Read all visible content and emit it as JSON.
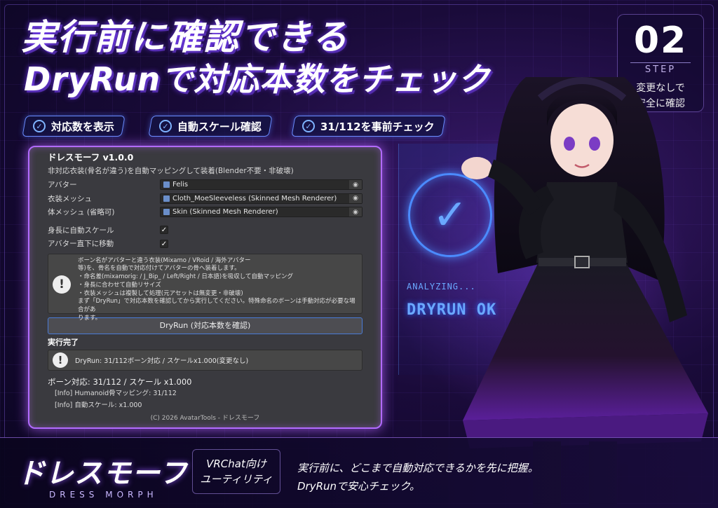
{
  "headline": {
    "line1": "実行前に確認できる",
    "line2": "DryRunで対応本数をチェック"
  },
  "step": {
    "number": "02",
    "label": "STEP",
    "desc_line1": "変更なしで",
    "desc_line2": "安全に確認"
  },
  "chips": [
    {
      "label": "対応数を表示"
    },
    {
      "label": "自動スケール確認"
    },
    {
      "label": "31/112を事前チェック"
    }
  ],
  "panel": {
    "title": "ドレスモーフ v1.0.0",
    "subtitle": "非対応衣装(骨名が違う)を自動マッピングして装着(Blender不要・非破壊)",
    "fields": [
      {
        "label": "アバター",
        "value": "Felis"
      },
      {
        "label": "衣装メッシュ",
        "value": "Cloth_MoeSleeveless (Skinned Mesh Renderer)"
      },
      {
        "label": "体メッシュ (省略可)",
        "value": "Skin (Skinned Mesh Renderer)"
      }
    ],
    "toggles": [
      {
        "label": "身長に自動スケール",
        "check": "✓"
      },
      {
        "label": "アバター直下に移動",
        "check": "✓"
      }
    ],
    "help_lines": [
      "ボーン名がアバターと違う衣装(Mixamo / VRoid / 海外アバター",
      "等)を、骨名を自動で対応付けてアバターの骨へ装着します。",
      "・命名差(mixamorig: / J_Bip_ / Left/Right / 日本語)を吸収して自動マッピング",
      "・身長に合わせて自動リサイズ",
      "・衣装メッシュは複製して処理(元アセットは無変更・非破壊)",
      "まず「DryRun」で対応本数を確認してから実行してください。特殊命名のボーンは手動対応が必要な場合があ",
      "ります。"
    ],
    "help_icon": "!",
    "dryrun_button": "DryRun (対応本数を確認)",
    "result_heading": "実行完了",
    "result_icon": "!",
    "result_text": "DryRun: 31/112ボーン対応 / スケールx1.000(変更なし)",
    "summary": "ボーン対応: 31/112 / スケール x1.000",
    "info_lines": [
      "[Info] Humanoid骨マッピング: 31/112",
      "[Info] 自動スケール: x1.000"
    ],
    "copyright": "(C) 2026 AvatarTools - ドレスモーフ"
  },
  "hologram": {
    "analyzing": "ANALYZING...",
    "status": "DRYRUN OK"
  },
  "footer": {
    "logo_jp": "ドレスモーフ",
    "logo_en": "DRESS MORPH",
    "vrc_line1": "VRChat向け",
    "vrc_line2": "ユーティリティ",
    "tagline1": "実行前に、どこまで自動対応できるかを先に把握。",
    "tagline2": "DryRunで安心チェック。"
  },
  "colors": {
    "accent_purple": "#b26bff",
    "accent_blue": "#4b8bff",
    "panel_bg": "#3a3a3f"
  }
}
